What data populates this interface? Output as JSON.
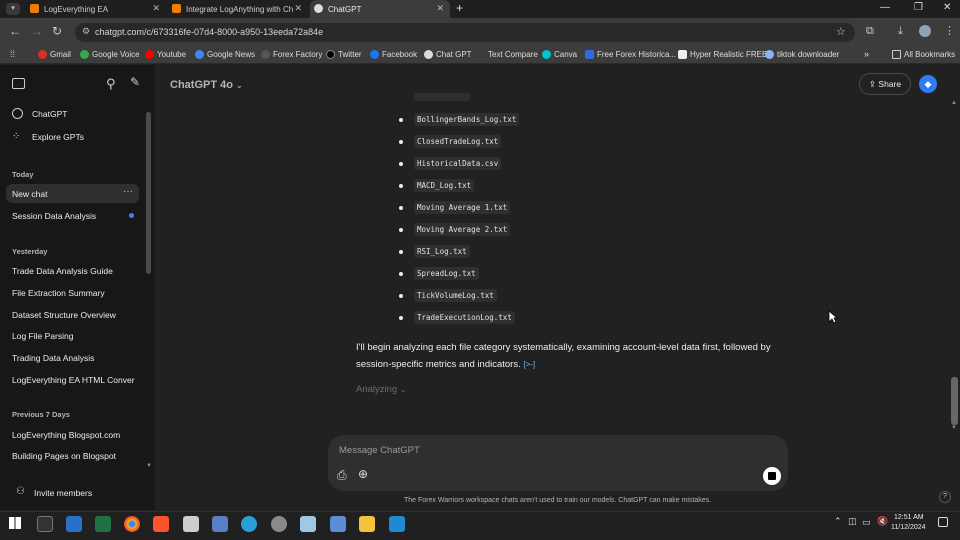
{
  "browser": {
    "tabs": [
      {
        "title": "LogEverything EA"
      },
      {
        "title": "Integrate LogAnything with Ch"
      },
      {
        "title": "ChatGPT"
      }
    ],
    "url": "chatgpt.com/c/673316fe-07d4-8000-a950-13eeda72a84e",
    "bookmarks": [
      "Gmail",
      "Google Voice",
      "Youtube",
      "Google News",
      "Forex Factory",
      "Twitter",
      "Facebook",
      "Chat GPT",
      "Text Compare",
      "Canva",
      "Free Forex Historica...",
      "Hyper Realistic FREE",
      "tiktok downloader"
    ],
    "all_bookmarks": "All Bookmarks",
    "more_bookmarks": "»"
  },
  "sidebar": {
    "top_items": [
      "ChatGPT",
      "Explore GPTs"
    ],
    "today_label": "Today",
    "today": [
      "New chat",
      "Session Data Analysis"
    ],
    "yesterday_label": "Yesterday",
    "yesterday": [
      "Trade Data Analysis Guide",
      "File Extraction Summary",
      "Dataset Structure Overview",
      "Log File Parsing",
      "Trading Data Analysis",
      "LogEverything EA HTML Conver"
    ],
    "prev7_label": "Previous 7 Days",
    "prev7": [
      "LogEverything Blogspot.com",
      "Building Pages on Blogspot"
    ],
    "invite": "Invite members"
  },
  "header": {
    "model": "ChatGPT 4o",
    "share": "Share"
  },
  "conversation": {
    "files": [
      "BollingerBands_Log.txt",
      "ClosedTradeLog.txt",
      "HistoricalData.csv",
      "MACD_Log.txt",
      "Moving Average 1.txt",
      "Moving Average 2.txt",
      "RSI_Log.txt",
      "SpreadLog.txt",
      "TickVolumeLog.txt",
      "TradeExecutionLog.txt"
    ],
    "paragraph": "I'll begin analyzing each file category systematically, examining account-level data first, followed by session-specific metrics and indicators.",
    "citation": "[>-]",
    "status": "Analyzing"
  },
  "composer": {
    "placeholder": "Message ChatGPT"
  },
  "footer": {
    "notice": "The Forex Warriors workspace chats aren't used to train our models. ChatGPT can make mistakes.",
    "help": "?"
  },
  "taskbar": {
    "time": "12:51 AM",
    "date": "11/12/2024"
  }
}
